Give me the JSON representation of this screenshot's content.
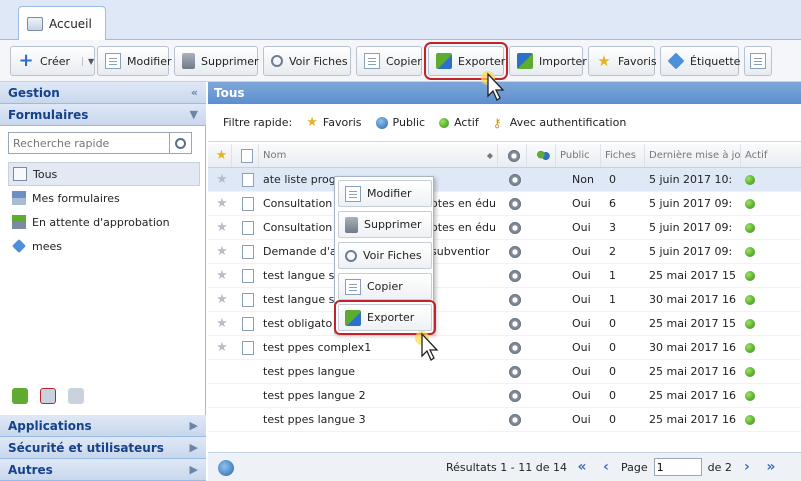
{
  "tab": {
    "label": "Accueil"
  },
  "toolbar": {
    "create": "Créer",
    "modify": "Modifier",
    "delete": "Supprimer",
    "view": "Voir Fiches",
    "copy": "Copier",
    "export": "Exporter",
    "import": "Importer",
    "favorites": "Favoris",
    "label": "Étiquette"
  },
  "left": {
    "gestion": "Gestion",
    "formulaires": "Formulaires",
    "search_placeholder": "Recherche rapide",
    "items": [
      {
        "label": "Tous"
      },
      {
        "label": "Mes formulaires"
      },
      {
        "label": "En attente d'approbation"
      },
      {
        "label": "mees"
      }
    ],
    "applications": "Applications",
    "security": "Sécurité et utilisateurs",
    "others": "Autres"
  },
  "main": {
    "title": "Tous",
    "filter_label": "Filtre rapide:",
    "filters": [
      "Favoris",
      "Public",
      "Actif",
      "Avec authentification"
    ],
    "columns": {
      "name": "Nom",
      "public": "Public",
      "fiches": "Fiches",
      "updated": "Dernière mise à jour",
      "active": "Actif"
    },
    "rows": [
      {
        "name": "ate liste progr",
        "public": "Non",
        "fiches": "0",
        "date": "5 juin 2017 10:"
      },
      {
        "name": "Consultation s",
        "tail": "otes en édu",
        "public": "Oui",
        "fiches": "6",
        "date": "5 juin 2017 09:"
      },
      {
        "name": "Consultation s",
        "tail": "otes en édu",
        "public": "Oui",
        "fiches": "3",
        "date": "5 juin 2017 09:"
      },
      {
        "name": "Demande d'a",
        "tail": "subventior",
        "public": "Oui",
        "fiches": "2",
        "date": "5 juin 2017 09:"
      },
      {
        "name": "test langue s",
        "public": "Oui",
        "fiches": "1",
        "date": "25 mai 2017 15"
      },
      {
        "name": "test langue s",
        "public": "Oui",
        "fiches": "1",
        "date": "30 mai 2017 16"
      },
      {
        "name": "test obligato",
        "public": "Oui",
        "fiches": "0",
        "date": "25 mai 2017 15"
      },
      {
        "name": "test ppes complex1",
        "public": "Oui",
        "fiches": "0",
        "date": "30 mai 2017 16"
      },
      {
        "name": "test ppes langue",
        "public": "Oui",
        "fiches": "0",
        "date": "25 mai 2017 16"
      },
      {
        "name": "test ppes langue 2",
        "public": "Oui",
        "fiches": "0",
        "date": "25 mai 2017 16"
      },
      {
        "name": "test ppes langue 3",
        "public": "Oui",
        "fiches": "0",
        "date": "25 mai 2017 16"
      }
    ],
    "results": "Résultats 1 - 11 de 14",
    "page_label": "Page",
    "page_value": "1",
    "page_of": "de 2"
  },
  "context_menu": {
    "modify": "Modifier",
    "delete": "Supprimer",
    "view": "Voir Fiches",
    "copy": "Copier",
    "export": "Exporter"
  },
  "colors": {
    "accent": "#5c8fd0",
    "highlight": "#c0242b",
    "active": "#2e8b12"
  }
}
